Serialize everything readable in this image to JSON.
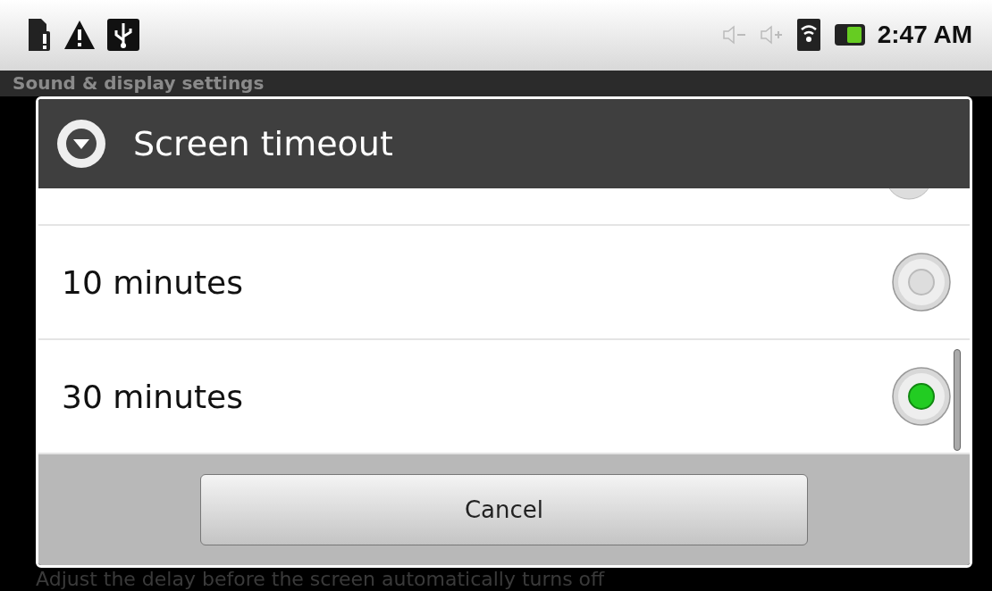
{
  "status_bar": {
    "time": "2:47 AM"
  },
  "header": {
    "title": "Sound & display settings"
  },
  "dialog": {
    "title": "Screen timeout",
    "options": [
      {
        "label": "10 minutes",
        "selected": false
      },
      {
        "label": "30 minutes",
        "selected": true
      }
    ],
    "buttons": [
      "Cancel"
    ]
  },
  "background_item": {
    "summary": "Adjust the delay before the screen automatically turns off"
  }
}
